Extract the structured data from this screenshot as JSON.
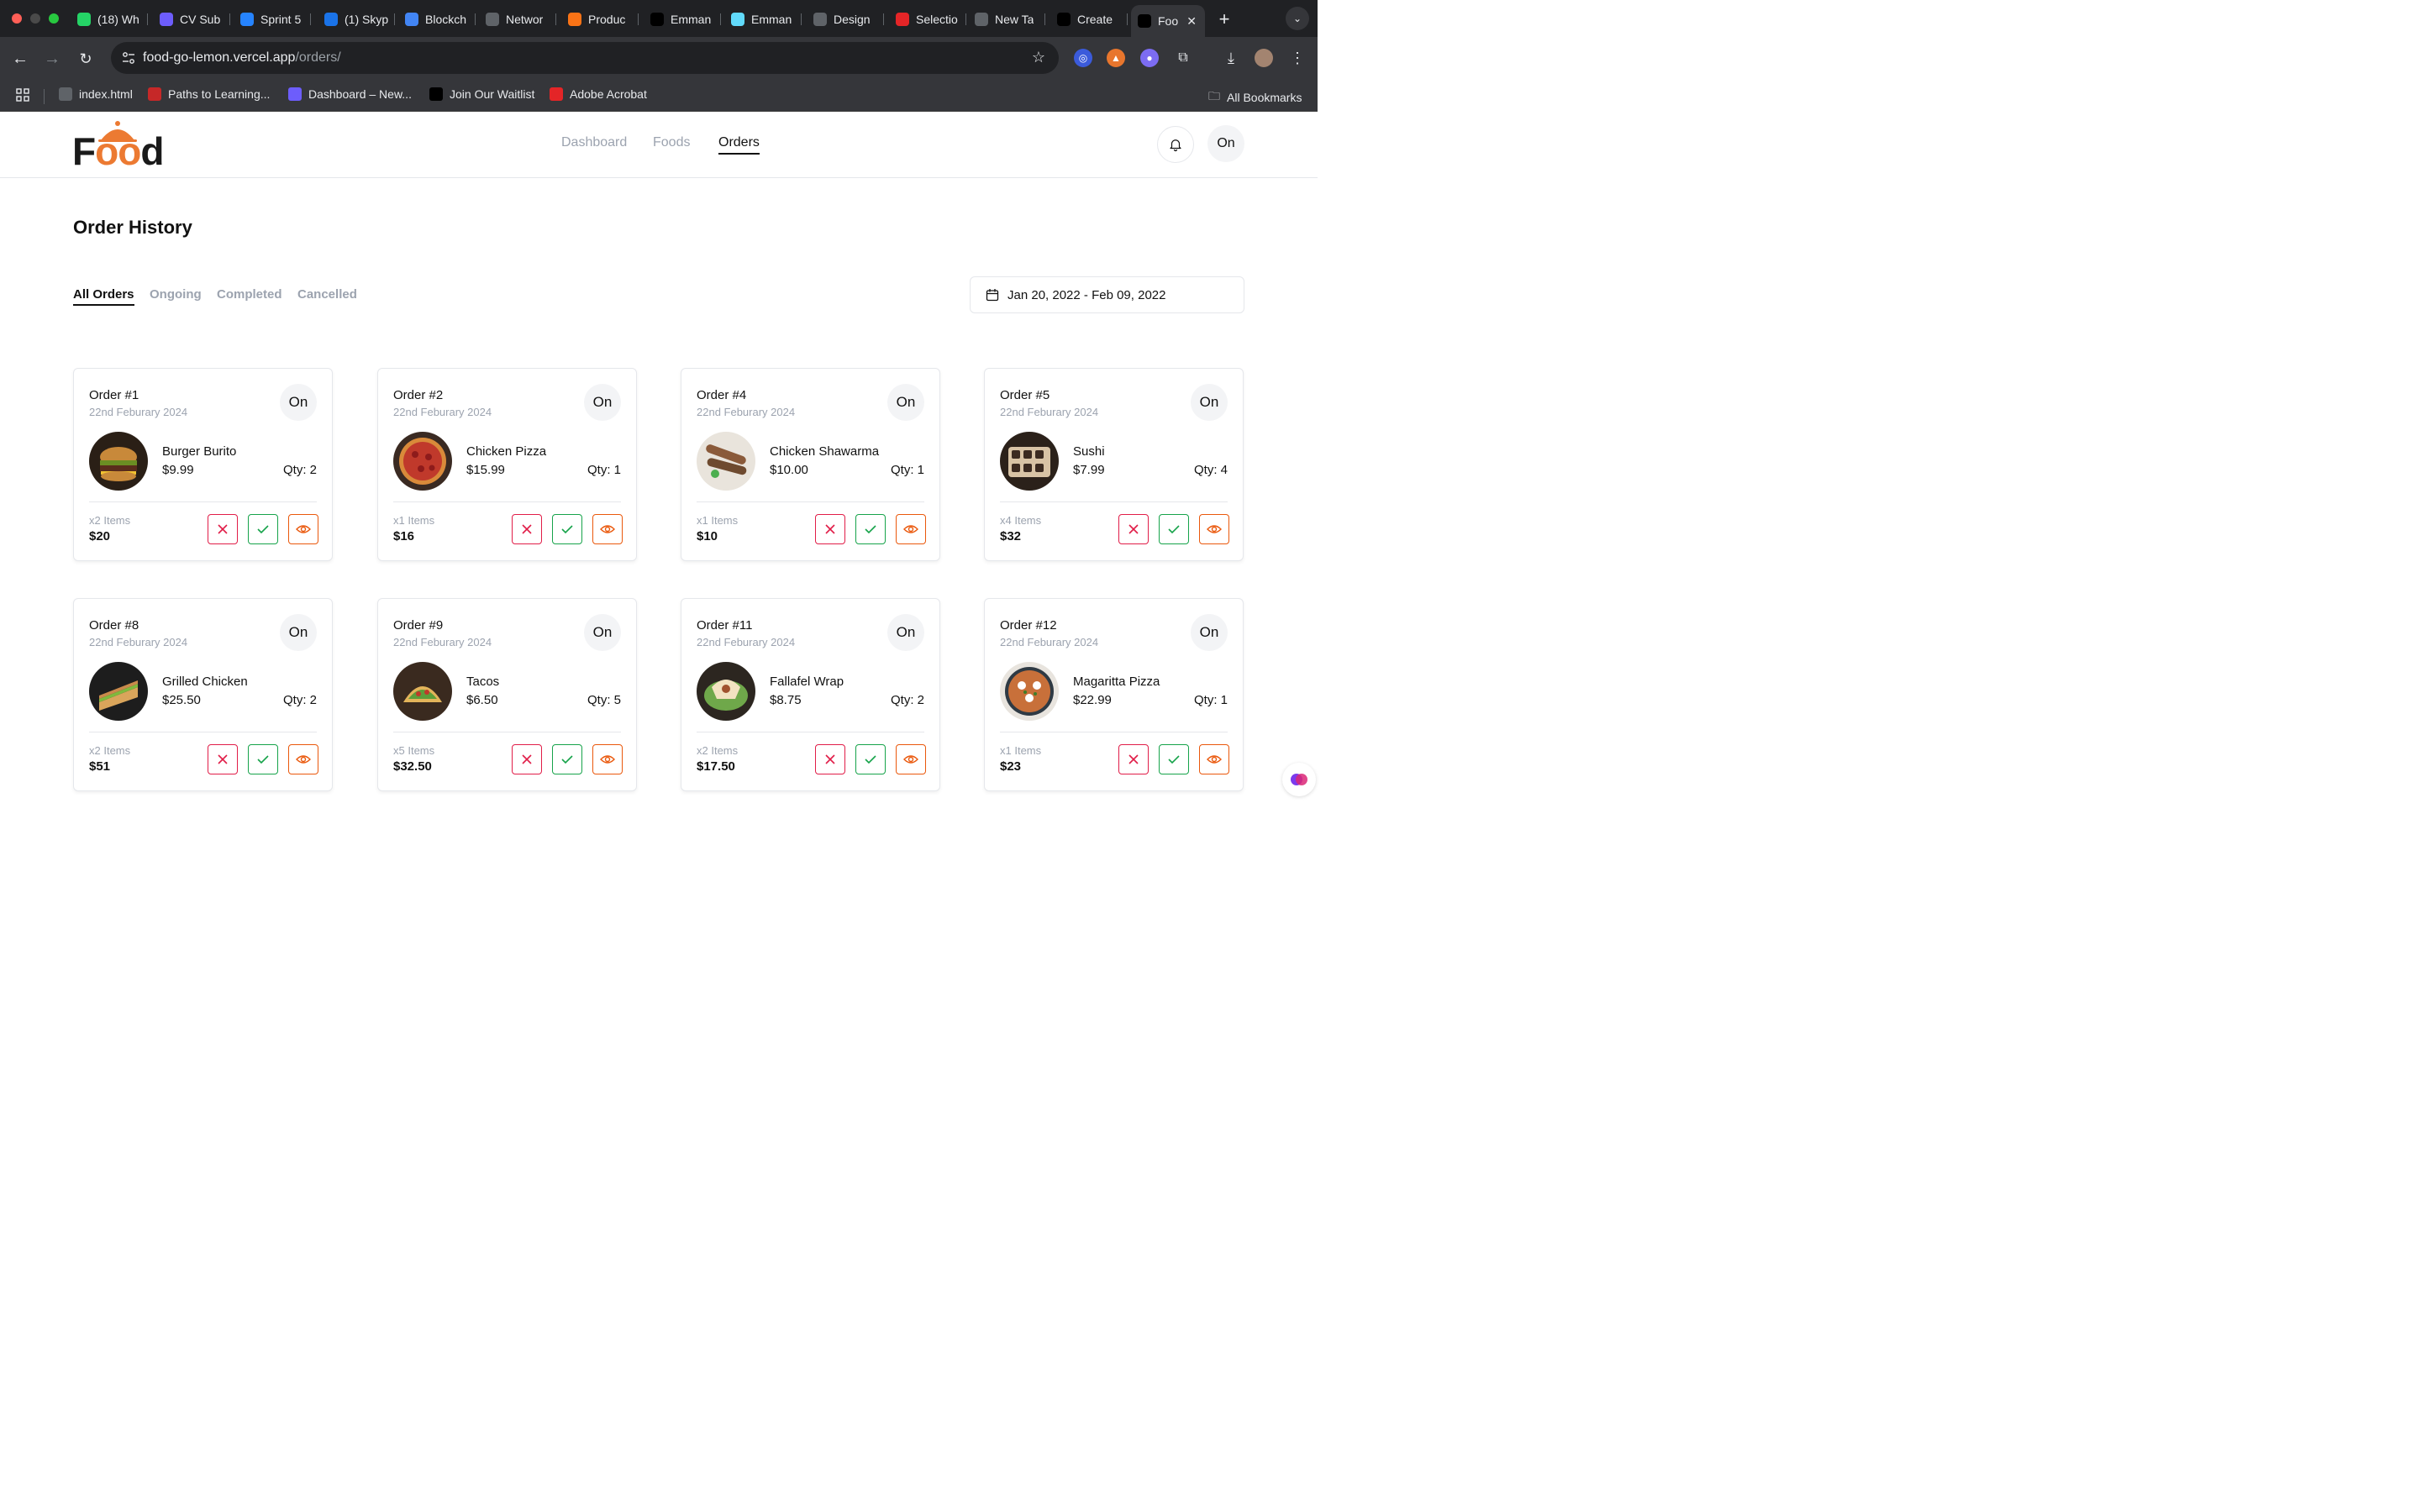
{
  "browser": {
    "tabs": [
      {
        "title": "(18) Wh",
        "favicon": "whatsapp-icon",
        "color": "#25d366"
      },
      {
        "title": "CV Sub",
        "favicon": "list-icon",
        "color": "#6d5dfc"
      },
      {
        "title": "Sprint 5",
        "favicon": "jira-icon",
        "color": "#2684ff"
      },
      {
        "title": "(1) Skyp",
        "favicon": "skype-icon",
        "color": "#1a73e8"
      },
      {
        "title": "Blockch",
        "favicon": "doc-icon",
        "color": "#4285f4"
      },
      {
        "title": "Networ",
        "favicon": "globe-icon",
        "color": "#5f6368"
      },
      {
        "title": "Produc",
        "favicon": "asterisk-icon",
        "color": "#f97316"
      },
      {
        "title": "Emman",
        "favicon": "vercel-icon",
        "color": "#000000"
      },
      {
        "title": "Emman",
        "favicon": "react-icon",
        "color": "#61dafb"
      },
      {
        "title": "Design",
        "favicon": "openai-icon",
        "color": "#5f6368"
      },
      {
        "title": "Selectio",
        "favicon": "zoho-icon",
        "color": "#e42527"
      },
      {
        "title": "New Ta",
        "favicon": "chrome-icon",
        "color": "#5f6368"
      },
      {
        "title": "Create",
        "favicon": "vercel-icon",
        "color": "#000000"
      },
      {
        "title": "Foo",
        "favicon": "vercel-icon",
        "color": "#000000",
        "active": true
      }
    ],
    "url_host": "food-go-lemon.vercel.app",
    "url_path": "/orders/",
    "bookmarks": [
      {
        "label": "index.html",
        "icon": "globe-icon"
      },
      {
        "label": "Paths to Learning...",
        "icon": "m-icon"
      },
      {
        "label": "Dashboard – New...",
        "icon": "s-icon"
      },
      {
        "label": "Join Our Waitlist",
        "icon": "vercel-icon"
      },
      {
        "label": "Adobe Acrobat",
        "icon": "acrobat-icon"
      }
    ],
    "all_bookmarks": "All Bookmarks"
  },
  "app": {
    "logo": {
      "prefix": "F",
      "oo": "oo",
      "suffix": "d"
    },
    "nav": [
      "Dashboard",
      "Foods",
      "Orders"
    ],
    "active_nav": "Orders",
    "avatar_label": "On",
    "page_title": "Order History",
    "filters": [
      "All Orders",
      "Ongoing",
      "Completed",
      "Cancelled"
    ],
    "date_range": "Jan 20, 2022 - Feb 09, 2022",
    "accent": "#ec7a32",
    "orders": [
      {
        "id": "Order #1",
        "date": "22nd Feburary 2024",
        "status": "On",
        "food": "Burger Burito",
        "price": "$9.99",
        "qty": "Qty: 2",
        "items": "x2 Items",
        "total": "$20",
        "img": "burger"
      },
      {
        "id": "Order #2",
        "date": "22nd Feburary 2024",
        "status": "On",
        "food": "Chicken Pizza",
        "price": "$15.99",
        "qty": "Qty: 1",
        "items": "x1 Items",
        "total": "$16",
        "img": "pizza"
      },
      {
        "id": "Order #4",
        "date": "22nd Feburary 2024",
        "status": "On",
        "food": "Chicken Shawarma",
        "price": "$10.00",
        "qty": "Qty: 1",
        "items": "x1 Items",
        "total": "$10",
        "img": "shawarma"
      },
      {
        "id": "Order #5",
        "date": "22nd Feburary 2024",
        "status": "On",
        "food": "Sushi",
        "price": "$7.99",
        "qty": "Qty: 4",
        "items": "x4 Items",
        "total": "$32",
        "img": "sushi"
      },
      {
        "id": "Order #8",
        "date": "22nd Feburary 2024",
        "status": "On",
        "food": "Grilled Chicken",
        "price": "$25.50",
        "qty": "Qty: 2",
        "items": "x2 Items",
        "total": "$51",
        "img": "sandwich"
      },
      {
        "id": "Order #9",
        "date": "22nd Feburary 2024",
        "status": "On",
        "food": "Tacos",
        "price": "$6.50",
        "qty": "Qty: 5",
        "items": "x5 Items",
        "total": "$32.50",
        "img": "tacos"
      },
      {
        "id": "Order #11",
        "date": "22nd Feburary 2024",
        "status": "On",
        "food": "Fallafel Wrap",
        "price": "$8.75",
        "qty": "Qty: 2",
        "items": "x2 Items",
        "total": "$17.50",
        "img": "wrap"
      },
      {
        "id": "Order #12",
        "date": "22nd Feburary 2024",
        "status": "On",
        "food": "Magaritta Pizza",
        "price": "$22.99",
        "qty": "Qty: 1",
        "items": "x1 Items",
        "total": "$23",
        "img": "margherita"
      }
    ]
  }
}
